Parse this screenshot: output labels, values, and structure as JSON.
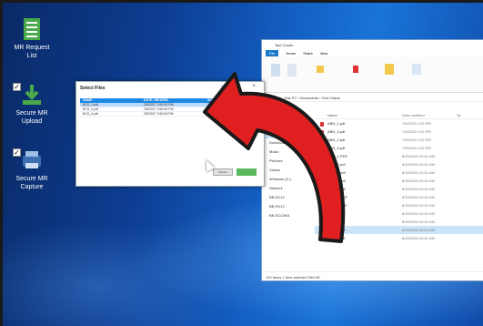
{
  "desktop_icons": [
    {
      "name": "mr-request-list",
      "label": "MR Request\nList",
      "color": "#4aa94a"
    },
    {
      "name": "secure-mr-upload",
      "label": "Secure MR\nUpload",
      "color": "#4aa94a"
    },
    {
      "name": "secure-mr-capture",
      "label": "Secure MR\nCapture",
      "color": "#3a6fb0"
    }
  ],
  "dialog": {
    "title": "Select Files",
    "columns": [
      "NAME",
      "DATE CREATED",
      "SIZE"
    ],
    "rows": [
      {
        "name": "BCS_1.pdf",
        "date": "2/8/2017 3:50:05 PM",
        "size": "141,184",
        "selected": true
      },
      {
        "name": "BCS_3.pdf",
        "date": "2/8/2017 3:50:06 PM",
        "size": "342,888",
        "selected": false
      },
      {
        "name": "BCS_4.pdf",
        "date": "2/8/2017 3:50:06 PM",
        "size": "141,184",
        "selected": false
      }
    ],
    "cancel_label": "Cancel",
    "window_controls": "–  □  ×"
  },
  "explorer": {
    "title": "Test Charts",
    "tabs": [
      "File",
      "Home",
      "Share",
      "View"
    ],
    "address": "This PC  ›  Documents  ›  Test Charts",
    "columns": [
      "Name",
      "Date modified",
      "Ty"
    ],
    "nav": [
      {
        "label": "Quick access",
        "sel": false
      },
      {
        "label": "Desktop",
        "sel": false
      },
      {
        "label": "Documents",
        "sel": true
      },
      {
        "label": "Downloads",
        "sel": false
      },
      {
        "label": "Music",
        "sel": false
      },
      {
        "label": "Pictures",
        "sel": false
      },
      {
        "label": "Videos",
        "sel": false
      },
      {
        "label": "Windows (C:)",
        "sel": false
      },
      {
        "label": "Network",
        "sel": false
      },
      {
        "label": "BB-DC12",
        "sel": false
      },
      {
        "label": "BB-HV12",
        "sel": false
      },
      {
        "label": "BB-SCCM01",
        "sel": false
      }
    ],
    "files": [
      {
        "name": "ABN_1.pdf",
        "date": "7/9/2016 1:02 PM",
        "sel": false
      },
      {
        "name": "ABN_3.pdf",
        "date": "7/9/2016 1:02 PM",
        "sel": false
      },
      {
        "name": "ABN_4.pdf",
        "date": "7/9/2016 1:02 PM",
        "sel": false
      },
      {
        "name": "ABN_5.pdf",
        "date": "7/9/2016 1:02 PM",
        "sel": false
      },
      {
        "name": "AHD_1.PDF",
        "date": "8/15/2016 10:01 AM",
        "sel": false
      },
      {
        "name": "AHD_2.pdf",
        "date": "8/15/2016 10:01 AM",
        "sel": false
      },
      {
        "name": "AHD_3.pdf",
        "date": "8/15/2016 10:01 AM",
        "sel": false
      },
      {
        "name": "AHD_4.pdf",
        "date": "8/15/2016 10:01 AM",
        "sel": false
      },
      {
        "name": "AHD_5.pdf",
        "date": "8/15/2016 10:01 AM",
        "sel": false
      },
      {
        "name": "AHD_1.PDF",
        "date": "8/15/2016 10:01 AM",
        "sel": false
      },
      {
        "name": "BCS_1.PDF",
        "date": "8/15/2016 10:01 AM",
        "sel": false
      },
      {
        "name": "BCS_2.pdf",
        "date": "8/15/2016 10:01 AM",
        "sel": false
      },
      {
        "name": "BCS_3.pdf",
        "date": "8/15/2016 10:01 AM",
        "sel": false
      },
      {
        "name": "BCS_4.pdf",
        "date": "8/15/2016 10:01 AM",
        "sel": true
      },
      {
        "name": "BCS_5.pdf",
        "date": "8/15/2016 10:01 AM",
        "sel": false
      }
    ],
    "status": "102 items    1 item selected  554 KB"
  },
  "colors": {
    "arrow": "#e02020",
    "accent": "#1e88e5"
  }
}
